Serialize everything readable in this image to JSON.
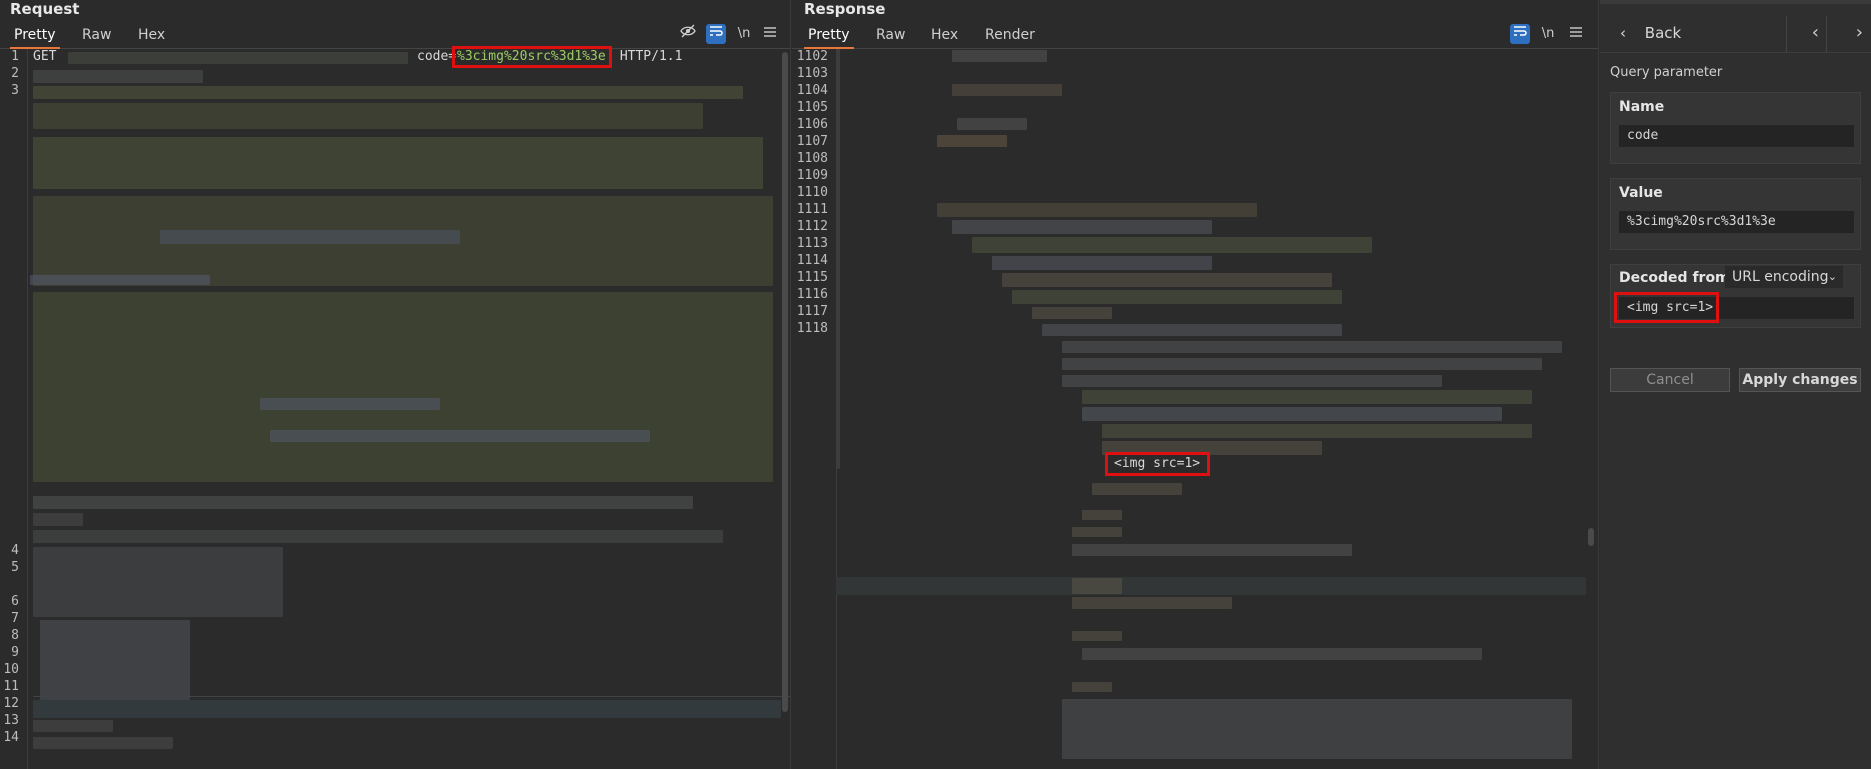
{
  "request": {
    "title": "Request",
    "tabs": [
      "Pretty",
      "Raw",
      "Hex"
    ],
    "active_tab": "Pretty",
    "tools": {
      "hide_icon": "eye-slash-icon",
      "wrap_icon": "wrap-lines-icon",
      "newline_label": "\\n",
      "menu_icon": "menu-icon"
    },
    "line_numbers": [
      "1",
      "2",
      "3",
      "4",
      "5",
      "6",
      "7",
      "8",
      "9",
      "10",
      "11",
      "12",
      "13",
      "14"
    ],
    "line1": {
      "method": "GET",
      "param": "code=",
      "value": "%3cimg%20src%3d1%3e",
      "version": " HTTP/1.1"
    }
  },
  "response": {
    "title": "Response",
    "tabs": [
      "Pretty",
      "Raw",
      "Hex",
      "Render"
    ],
    "active_tab": "Pretty",
    "tools": {
      "wrap_icon": "wrap-lines-icon",
      "newline_label": "\\n",
      "menu_icon": "menu-icon"
    },
    "line_numbers": [
      "1102",
      "1103",
      "1104",
      "1105",
      "1106",
      "1107",
      "1108",
      "1109",
      "1110",
      "1111",
      "1112",
      "1113",
      "1114",
      "1115",
      "1116",
      "1117",
      "1118"
    ],
    "reflected": "<img src=1>"
  },
  "inspector": {
    "back_label": "Back",
    "section_title": "Query parameter",
    "name_label": "Name",
    "name_value": "code",
    "value_label": "Value",
    "value_value": "%3cimg%20src%3d1%3e",
    "decoded_label": "Decoded from:",
    "decoded_option": "URL encoding",
    "decoded_value": "<img src=1>",
    "cancel_label": "Cancel",
    "apply_label": "Apply changes"
  },
  "colors": {
    "highlight": "#e01010",
    "accent": "#e8773a",
    "toggle_on": "#2e6fbf"
  }
}
